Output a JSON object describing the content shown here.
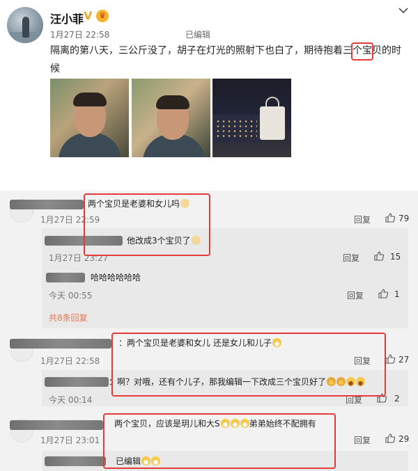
{
  "post": {
    "user_name": "汪小菲",
    "verified_badge": "V",
    "crown_icon": "crown-badge-icon",
    "time": "1月27日 22:58",
    "edited_label": "已编辑",
    "text": "隔离的第八天，三公斤没了，胡子在灯光的照射下也白了，期待抱着三个宝贝的时候",
    "images": [
      "selfie-photo-1",
      "selfie-photo-2",
      "night-city-bag-photo"
    ]
  },
  "comments": [
    {
      "text": "两个宝贝是老婆和女儿吗",
      "emojis": [
        "cat"
      ],
      "time": "1月27日 22:59",
      "reply_label": "回复",
      "likes": "79",
      "replies": [
        {
          "text": "他改成3个宝贝了",
          "emojis": [
            "cat"
          ],
          "time": "1月27日 23:27",
          "reply_label": "回复",
          "likes": "15"
        },
        {
          "text": "哈哈哈哈哈哈",
          "time": "今天 00:55",
          "reply_label": "回复",
          "likes": "1"
        }
      ],
      "more_replies": "共8条回复"
    },
    {
      "text": "：两个宝贝是老婆和女儿 还是女儿和儿子",
      "emojis": [
        "laugh"
      ],
      "time": "1月27日 22:58",
      "reply_label": "回复",
      "likes": "27",
      "replies": [
        {
          "text": "：啊？对哦，还有个儿子，那我编辑一下改成三个宝贝好了",
          "emojis": [
            "smile",
            "smile",
            "grin",
            "grin"
          ],
          "time": "今天 00:14",
          "reply_label": "回复",
          "likes": "2"
        }
      ]
    },
    {
      "text_before": "两个宝贝，应该是玥儿和大S",
      "text_after": "弟弟始终不配拥有",
      "emojis": [
        "laugh",
        "laugh",
        "laugh"
      ],
      "time": "1月27日 23:01",
      "reply_label": "回复",
      "likes": "29",
      "replies": [
        {
          "text": "已编辑",
          "emojis": [
            "laugh",
            "laugh"
          ]
        }
      ]
    }
  ],
  "colors": {
    "highlight": "#e53935",
    "link": "#eb7350",
    "comments_bg": "#f2f2f2"
  }
}
